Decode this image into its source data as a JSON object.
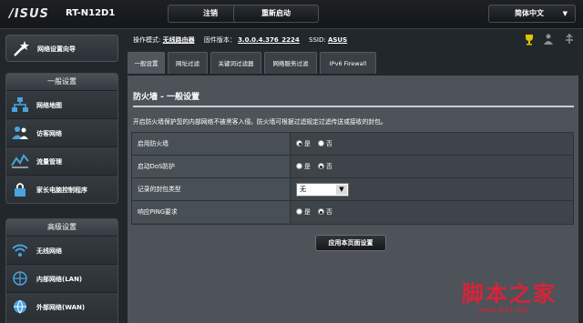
{
  "header": {
    "brand": "/ISUS",
    "model": "RT-N12D1",
    "logout_label": "注销",
    "reboot_label": "重新启动",
    "language": "简体中文"
  },
  "quick_setup": {
    "label": "网络设置向导",
    "icon": "magic-wand-icon"
  },
  "sidebar": {
    "general": {
      "title": "一般设置",
      "items": [
        {
          "label": "网络地图",
          "icon": "network-map-icon"
        },
        {
          "label": "访客网络",
          "icon": "guest-network-icon"
        },
        {
          "label": "流量管理",
          "icon": "traffic-manager-icon"
        },
        {
          "label": "家长电脑控制程序",
          "icon": "parental-control-icon"
        }
      ]
    },
    "advanced": {
      "title": "高级设置",
      "items": [
        {
          "label": "无线网络",
          "icon": "wireless-icon"
        },
        {
          "label": "内部网络(LAN)",
          "icon": "lan-icon"
        },
        {
          "label": "外部网络(WAN)",
          "icon": "wan-icon"
        }
      ]
    }
  },
  "info": {
    "mode_label": "操作模式:",
    "mode_value": "无线路由器",
    "firmware_label": "固件版本：",
    "firmware_value": "3.0.0.4.376_2224",
    "ssid_label": "SSID:",
    "ssid_value": "ASUS"
  },
  "tabs": [
    {
      "label": "一般设置",
      "active": true
    },
    {
      "label": "网址过滤",
      "active": false
    },
    {
      "label": "关键词过滤器",
      "active": false
    },
    {
      "label": "网络服务过滤",
      "active": false
    },
    {
      "label": "IPv6 Firewall",
      "active": false
    }
  ],
  "main": {
    "title": "防火墙 - 一般设置",
    "description": "开启防火墙保护您的内部网络不被黑客入侵。防火墙可根据过滤规定过滤传送或接收的封包。",
    "rows": [
      {
        "label": "启用防火墙",
        "type": "radio",
        "options": [
          "是",
          "否"
        ],
        "selected": 0
      },
      {
        "label": "启动DoS防护",
        "type": "radio",
        "options": [
          "是",
          "否"
        ],
        "selected": 1
      },
      {
        "label": "记录的封包类型",
        "type": "select",
        "value": "无"
      },
      {
        "label": "响应PING要求",
        "type": "radio",
        "options": [
          "是",
          "否"
        ],
        "selected": 1
      }
    ],
    "apply_label": "应用本页面设置"
  },
  "watermark": {
    "text": "脚本之家",
    "url": "www.jb51.net"
  },
  "colors": {
    "background": "#22272b",
    "panel": "#4d5358",
    "watermark": "#d8233a"
  }
}
